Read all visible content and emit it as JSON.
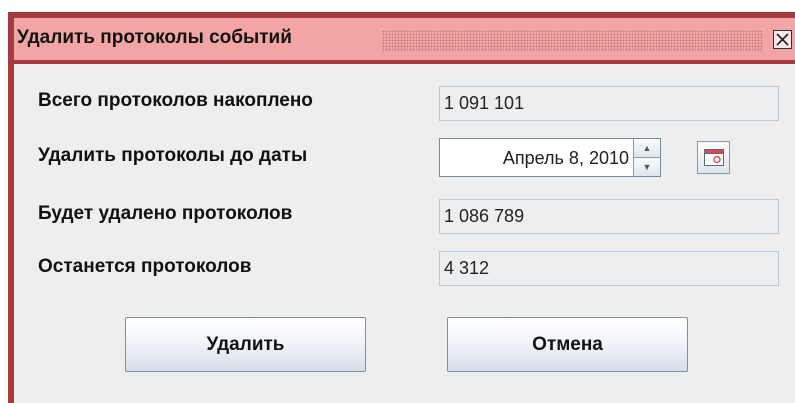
{
  "window": {
    "title": "Удалить протоколы событий"
  },
  "form": {
    "total_label": "Всего протоколов накоплено",
    "total_value": "1 091 101",
    "date_label": "Удалить протоколы до даты",
    "date_value": "Апрель 8, 2010",
    "will_delete_label": "Будет удалено протоколов",
    "will_delete_value": "1 086 789",
    "remain_label": "Останется протоколов",
    "remain_value": "4 312"
  },
  "buttons": {
    "delete_label": "Удалить",
    "cancel_label": "Отмена"
  },
  "colors": {
    "frame": "#a73a3f",
    "titlebar": "#f3a5a5",
    "content_bg": "#eeeeee",
    "field_border": "#b8c9da"
  },
  "icons": {
    "close": "close-icon",
    "calendar": "calendar-icon",
    "spin_up": "spin-up-icon",
    "spin_down": "spin-down-icon"
  }
}
